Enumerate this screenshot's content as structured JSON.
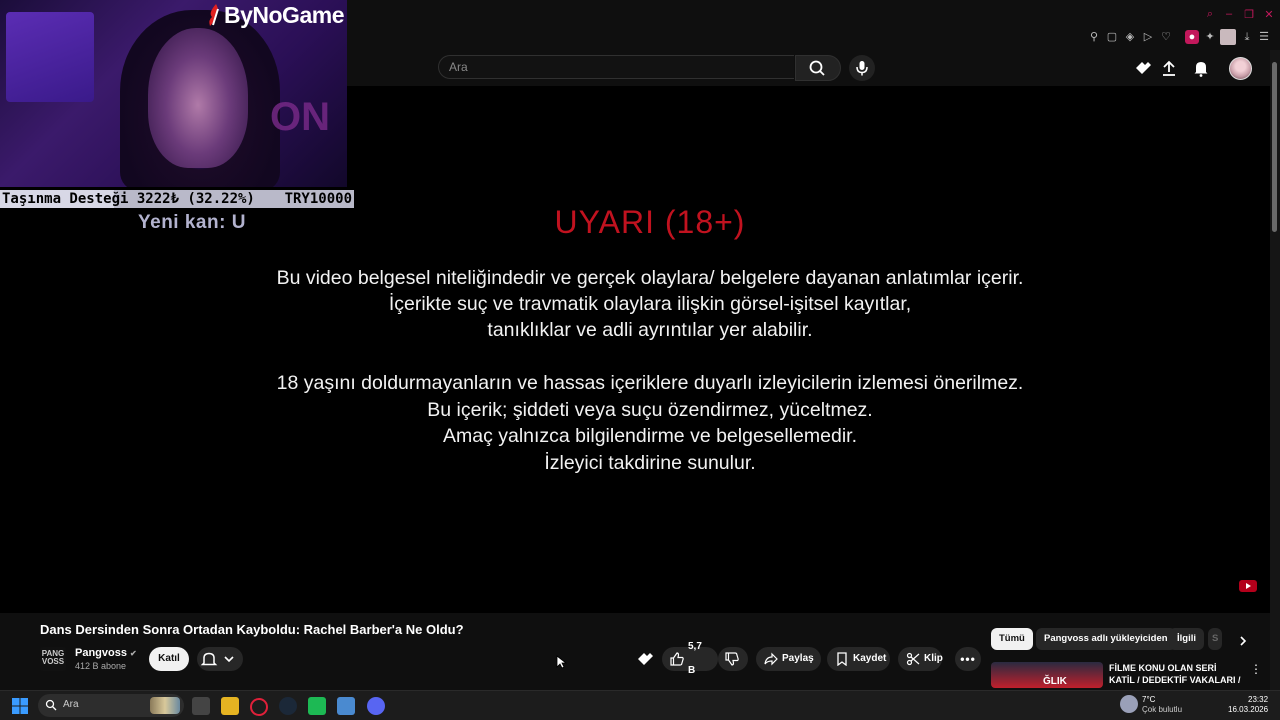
{
  "header": {
    "search_placeholder": "Ara"
  },
  "overlay": {
    "brand": "ByNoGame",
    "donation_text": "Taşınma Desteği 3222₺ (32.22%)",
    "donation_goal": "TRY10000",
    "donation_progress": 0.3222,
    "new_blood": "Yeni kan: U"
  },
  "player": {
    "warning_title": "UYARI (18+)",
    "paragraph1": [
      "Bu video belgesel niteliğindedir ve gerçek olaylara/ belgelere dayanan anlatımlar içerir.",
      "İçerikte suç ve travmatik olaylara ilişkin görsel-işitsel kayıtlar,",
      "tanıklıklar ve adli ayrıntılar yer alabilir."
    ],
    "paragraph2": [
      "18 yaşını doldurmayanların ve hassas içeriklere duyarlı izleyicilerin izlemesi önerilmez.",
      "Bu içerik; şiddeti veya suçu özendirmez, yüceltmez.",
      "Amaç yalnızca bilgilendirme ve belgesellemedir.",
      "İzleyici takdirine sunulur."
    ]
  },
  "video": {
    "title": "Dans Dersinden Sonra Ortadan Kayboldu: Rachel Barber'a Ne Oldu?",
    "channel_logo_text": "PANG VOSS",
    "channel_name": "Pangvoss",
    "subscribers": "412 B abone",
    "join_label": "Katıl",
    "like_count": "5,7 B",
    "share_label": "Paylaş",
    "save_label": "Kaydet",
    "clip_label": "Klip"
  },
  "recommendations": {
    "chips": [
      "Tümü",
      "Pangvoss adlı yükleyiciden",
      "İlgili",
      "S"
    ],
    "first_title": "FİLME KONU OLAN SERİ KATİL / DEDEKTİF VAKALARI /",
    "thumb_text": "ĞLIK"
  },
  "taskbar": {
    "search_label": "Ara",
    "temperature": "7°C",
    "weather": "Çok bulutlu",
    "time": "23:32",
    "date": "16.03.2026"
  },
  "colors": {
    "background": "#0f0f0f",
    "warning_red": "#c1121f",
    "accent_pink": "#c2185b"
  }
}
